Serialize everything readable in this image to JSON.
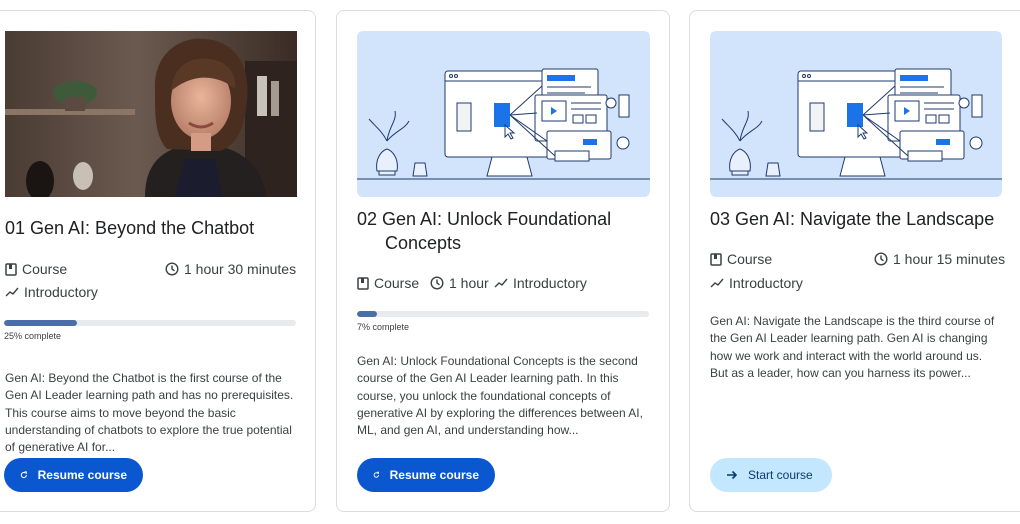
{
  "courses": [
    {
      "title": "01 Gen AI: Beyond the Chatbot",
      "type": "Course",
      "duration": "1 hour 30 minutes",
      "level": "Introductory",
      "progress": 25,
      "progress_label": "25% complete",
      "description": "Gen AI: Beyond the Chatbot is the first course of the Gen AI Leader learning path and has no prerequisites. This course aims to move beyond the basic understanding of chatbots to explore the true potential of generative AI for...",
      "button": "Resume course"
    },
    {
      "title_line1": "02 Gen AI: Unlock Foundational",
      "title_line2": "Concepts",
      "type": "Course",
      "duration": "1 hour",
      "level": "Introductory",
      "progress": 7,
      "progress_label": "7% complete",
      "description": "Gen AI: Unlock Foundational Concepts is the second course of the Gen AI Leader learning path. In this course, you unlock the foundational concepts of generative AI by exploring the differences between AI, ML, and gen AI, and understanding how...",
      "button": "Resume course"
    },
    {
      "title": "03 Gen AI: Navigate the Landscape",
      "type": "Course",
      "duration": "1 hour 15 minutes",
      "level": "Introductory",
      "description": "Gen AI: Navigate the Landscape is the third course of the Gen AI Leader learning path. Gen AI is changing how we work and interact with the world around us. But as a leader, how can you harness its power...",
      "button": "Start course"
    }
  ],
  "colors": {
    "primary_button": "#0b57d0",
    "secondary_button": "#c2e7ff",
    "progress_fill": "#4c6ea8",
    "illustration_bg": "#d2e3fc"
  }
}
